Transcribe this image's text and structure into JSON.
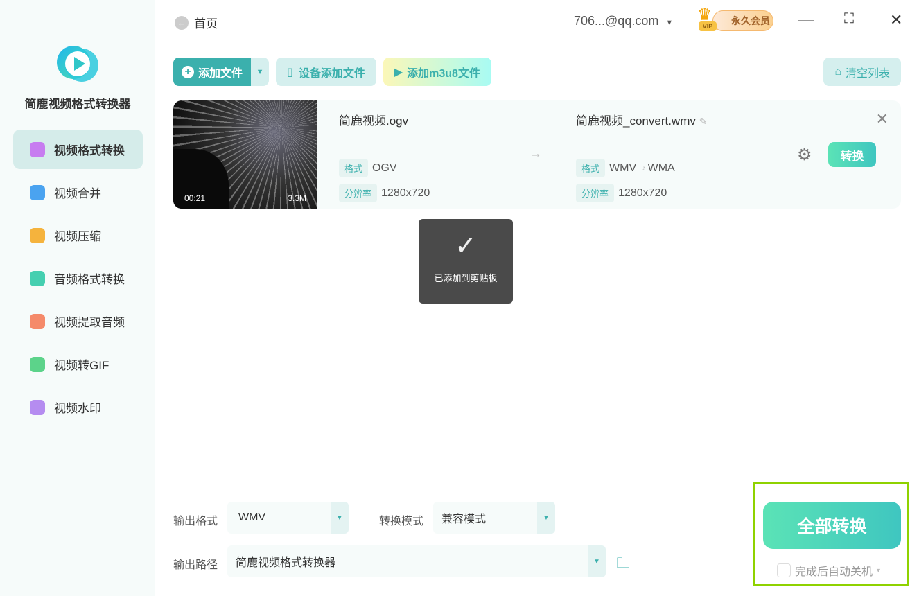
{
  "app": {
    "title": "简鹿视频格式转换器"
  },
  "sidebar": {
    "items": [
      {
        "label": "视频格式转换",
        "color": "#c77cf0"
      },
      {
        "label": "视频合并",
        "color": "#4aa3f0"
      },
      {
        "label": "视频压缩",
        "color": "#f5b33d"
      },
      {
        "label": "音频格式转换",
        "color": "#45cfb0"
      },
      {
        "label": "视频提取音频",
        "color": "#f58a6a"
      },
      {
        "label": "视频转GIF",
        "color": "#5cd38a"
      },
      {
        "label": "视频水印",
        "color": "#b58cf0"
      }
    ]
  },
  "header": {
    "back_label": "首页",
    "account": "706...@qq.com",
    "vip_label": "永久会员",
    "vip_badge": "VIP"
  },
  "toolbar": {
    "add_file": "添加文件",
    "device_add": "设备添加文件",
    "add_m3u8": "添加m3u8文件",
    "clear_list": "清空列表"
  },
  "file": {
    "duration": "00:21",
    "size": "3.3M",
    "source_name": "简鹿视频.ogv",
    "target_name": "简鹿视频_convert.wmv",
    "format_label": "格式",
    "resolution_label": "分辨率",
    "source_format": "OGV",
    "source_resolution": "1280x720",
    "target_format": "WMV",
    "target_audio": "WMA",
    "target_resolution": "1280x720",
    "convert_label": "转换"
  },
  "toast": {
    "message": "已添加到剪贴板"
  },
  "bottom": {
    "output_format_label": "输出格式",
    "output_format": "WMV",
    "mode_label": "转换模式",
    "mode": "兼容模式",
    "path_label": "输出路径",
    "path": "简鹿视频格式转换器",
    "convert_all": "全部转换",
    "shutdown_label": "完成后自动关机"
  }
}
